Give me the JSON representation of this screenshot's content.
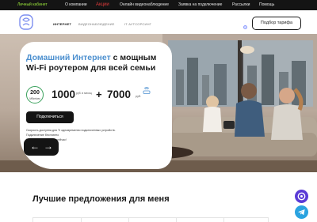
{
  "topbar": {
    "account": "Личный кабинет",
    "about": "О компании",
    "promo": "Акции",
    "video": "Онлайн видеонаблюдение",
    "request": "Заявка на подключение",
    "mailing": "Рассылки",
    "help": "Помощь"
  },
  "nav": {
    "internet": "ИНТЕРНЕТ",
    "video": "ВИДЕОНАБЛЮДЕНИЕ",
    "it": "IT АУТСОРСИНГ",
    "pick_tariff": "Подбор тарифа"
  },
  "hero": {
    "title_blue": "Домашний Интернет",
    "title_rest": " с мощным",
    "title_line2": "Wi-Fi роутером для всей семьи",
    "speed_value": "200",
    "speed_unit": "Мбит/сек",
    "price": "1000",
    "price_note": "руб. в месяц",
    "plus": "+",
    "bonus": "7000",
    "bonus_currency": "руб.",
    "connect_button": "Подключиться",
    "fine1": "Скорость доступна для Tr одновременно подключенных устройств.",
    "fine2": "Подключение бесплатно",
    "fine3": "Подключайтесь прямо сейчас!",
    "prev": "←",
    "next": "→"
  },
  "offers": {
    "title": "Лучшие предложения для меня"
  },
  "colors": {
    "accent_blue": "#4b8fcf",
    "promo_red": "#e23b3b",
    "account_green": "#9ae63b",
    "dark": "#141414",
    "speed_green": "#3aa15c"
  }
}
